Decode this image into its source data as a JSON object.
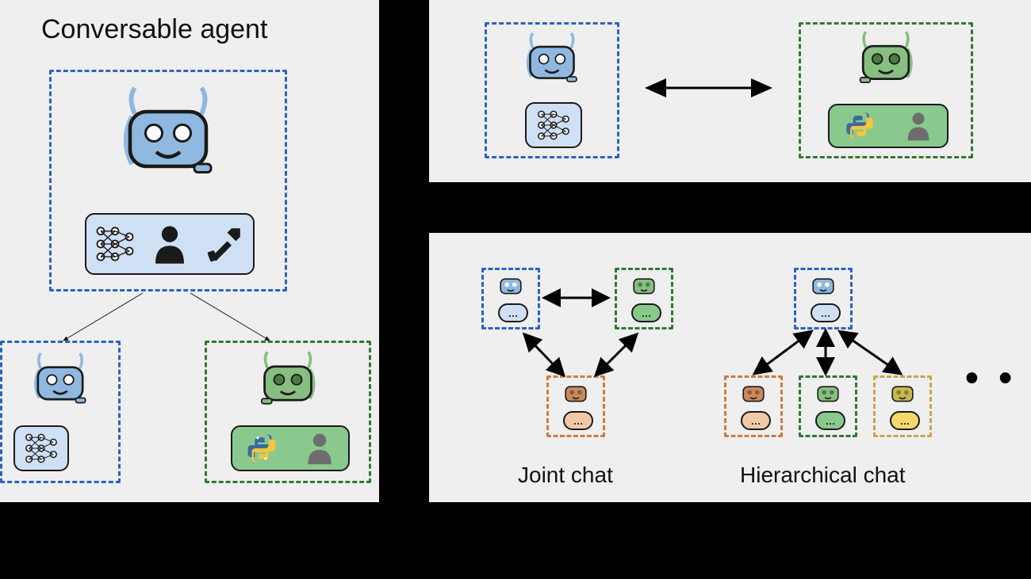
{
  "left_panel": {
    "title": "Conversable agent"
  },
  "right_bottom": {
    "joint_label": "Joint chat",
    "hier_label": "Hierarchical chat"
  },
  "ellipsis": "…",
  "mini_dots": "…",
  "big_ellipsis": "• •"
}
